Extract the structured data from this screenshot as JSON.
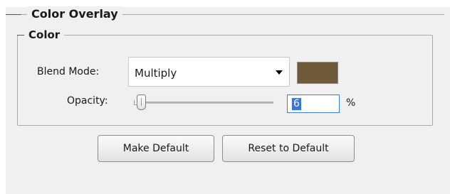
{
  "section": {
    "title": "Color Overlay",
    "group_title": "Color"
  },
  "blend_mode": {
    "label": "Blend Mode:",
    "value": "Multiply"
  },
  "color": {
    "swatch": "#6e5a3b"
  },
  "opacity": {
    "label": "Opacity:",
    "value": "6",
    "unit": "%",
    "fraction": 0.06
  },
  "buttons": {
    "make_default": "Make Default",
    "reset_default": "Reset to Default"
  },
  "icons": {
    "dropdown": "chevron-down-icon"
  }
}
